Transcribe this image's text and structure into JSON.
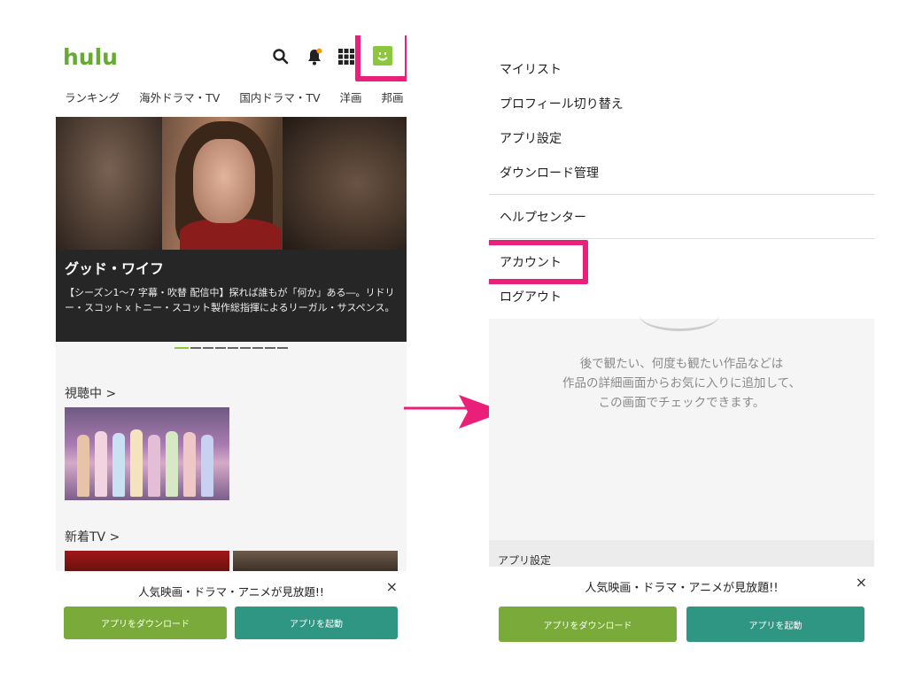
{
  "left": {
    "logo": "hulu",
    "icons": [
      "search-icon",
      "bell-icon",
      "grid-icon",
      "avatar-icon"
    ],
    "nav": [
      "ランキング",
      "海外ドラマ・TV",
      "国内ドラマ・TV",
      "洋画",
      "邦画"
    ],
    "hero": {
      "title": "グッド・ワイフ",
      "description": "【シーズン1〜7 字幕・吹替 配信中】探れば誰もが「何か」ある―。リドリー・スコットｘトニー・スコット製作総指揮によるリーガル・サスペンス。"
    },
    "sections": {
      "watching": "視聴中  >",
      "new_tv": "新着TV  >"
    },
    "banner": {
      "text": "人気映画・ドラマ・アニメが見放題!!",
      "close": "×",
      "download": "アプリをダウンロード",
      "launch": "アプリを起動"
    }
  },
  "right": {
    "menu": [
      "マイリスト",
      "プロフィール切り替え",
      "アプリ設定",
      "ダウンロード管理"
    ],
    "help": "ヘルプセンター",
    "account": "アカウント",
    "logout": "ログアウト",
    "empty_lines": [
      "後で観たい、何度も観たい作品などは",
      "作品の詳細画面からお気に入りに追加して、",
      "この画面でチェックできます。"
    ],
    "section_label": "アプリ設定",
    "banner": {
      "text": "人気映画・ドラマ・アニメが見放題!!",
      "close": "×",
      "download": "アプリをダウンロード",
      "launch": "アプリを起動"
    }
  },
  "colors": {
    "brand": "#66aa33",
    "highlight": "#ea1f7a",
    "green_button": "#7aab3a",
    "teal_button": "#2e9682"
  }
}
